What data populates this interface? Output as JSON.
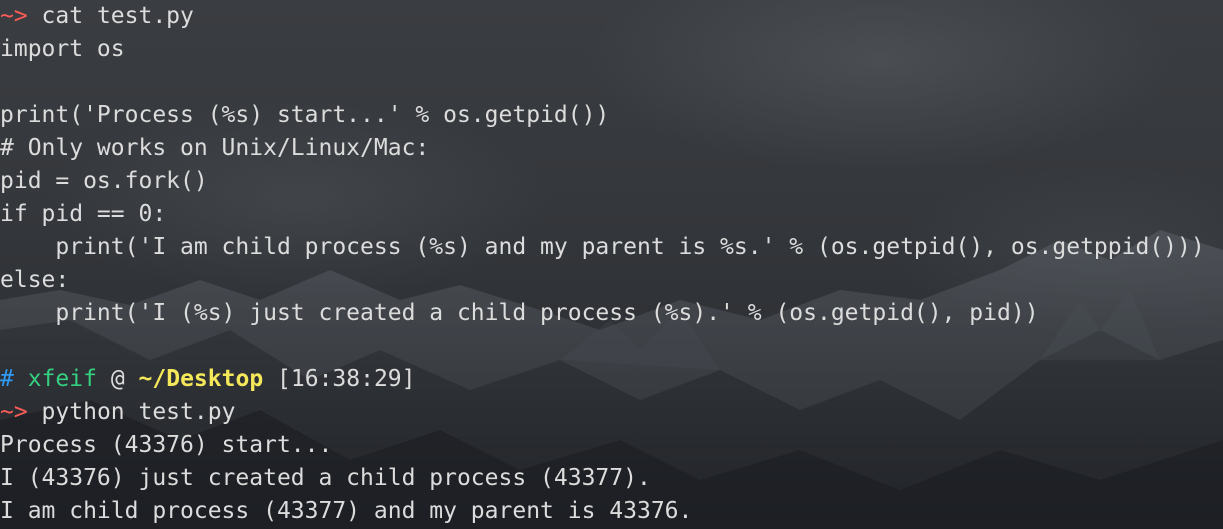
{
  "terminal": {
    "lines": [
      {
        "kind": "command",
        "prompt": "~>",
        "command": " cat test.py"
      },
      {
        "kind": "output",
        "text": "import os"
      },
      {
        "kind": "output",
        "text": ""
      },
      {
        "kind": "output",
        "text": "print('Process (%s) start...' % os.getpid())"
      },
      {
        "kind": "output",
        "text": "# Only works on Unix/Linux/Mac:"
      },
      {
        "kind": "output",
        "text": "pid = os.fork()"
      },
      {
        "kind": "output",
        "text": "if pid == 0:"
      },
      {
        "kind": "output",
        "text": "    print('I am child process (%s) and my parent is %s.' % (os.getpid(), os.getppid()))"
      },
      {
        "kind": "output",
        "text": "else:"
      },
      {
        "kind": "output",
        "text": "    print('I (%s) just created a child process (%s).' % (os.getpid(), pid))"
      },
      {
        "kind": "output",
        "text": ""
      },
      {
        "kind": "status",
        "hash": "#",
        "user": "xfeif",
        "at": "@",
        "path": "~/Desktop",
        "time": "[16:38:29]"
      },
      {
        "kind": "command",
        "prompt": "~>",
        "command": " python test.py"
      },
      {
        "kind": "output",
        "text": "Process (43376) start..."
      },
      {
        "kind": "output",
        "text": "I (43376) just created a child process (43377)."
      },
      {
        "kind": "output",
        "text": "I am child process (43377) and my parent is 43376."
      }
    ]
  },
  "colors": {
    "prompt": "#ff5c57",
    "hash": "#2f9bf5",
    "user": "#35d07f",
    "path": "#f4e85a",
    "text": "#dcdcdc"
  }
}
